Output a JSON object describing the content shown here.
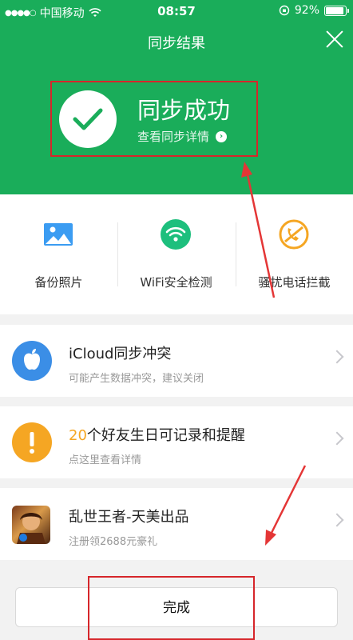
{
  "status_bar": {
    "carrier": "中国移动",
    "time": "08:57",
    "battery": "92%",
    "battery_level": 0.92
  },
  "nav": {
    "title": "同步结果"
  },
  "result": {
    "title": "同步成功",
    "detail_link": "查看同步详情"
  },
  "tools": [
    {
      "label": "备份照片",
      "icon": "photo-icon",
      "color": "#3b9cf2"
    },
    {
      "label": "WiFi安全检测",
      "icon": "wifi-icon",
      "color": "#1dbf7d"
    },
    {
      "label": "骚扰电话拦截",
      "icon": "block-call-icon",
      "color": "#f5a623"
    }
  ],
  "cards": [
    {
      "title": "iCloud同步冲突",
      "subtitle": "可能产生数据冲突，建议关闭",
      "icon": "apple-icon",
      "color": "#3b8ee6"
    },
    {
      "title_highlight": "20",
      "title_rest": "个好友生日可记录和提醒",
      "subtitle": "点这里查看详情",
      "icon": "exclamation-icon",
      "color": "#f5a623"
    },
    {
      "title": "乱世王者-天美出品",
      "subtitle": "注册领2688元豪礼",
      "icon": "game-icon"
    }
  ],
  "done_button": "完成",
  "colors": {
    "brand_green": "#1aad5a",
    "annotation_red": "#d6262b"
  }
}
